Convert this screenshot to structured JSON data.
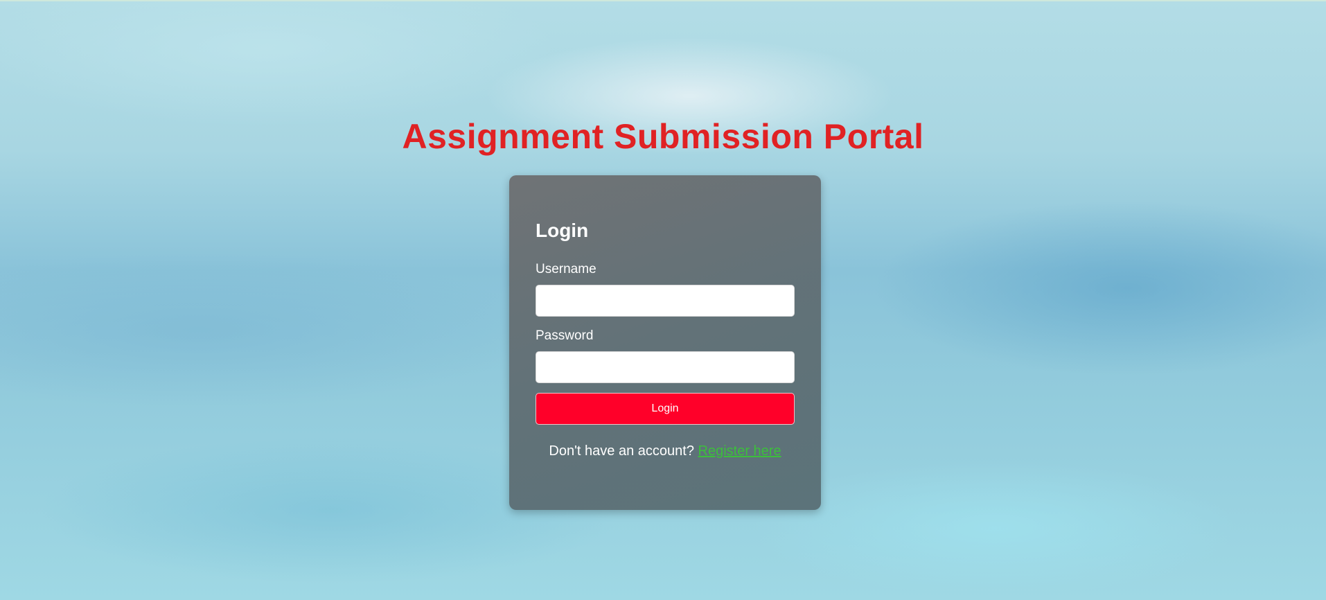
{
  "page": {
    "title": "Assignment Submission Portal"
  },
  "login_form": {
    "heading": "Login",
    "username_label": "Username",
    "username_value": "",
    "password_label": "Password",
    "password_value": "",
    "submit_label": "Login",
    "register_prompt": "Don't have an account?",
    "register_link_text": "Register here"
  },
  "colors": {
    "title": "#e02224",
    "button": "#ff0029",
    "link": "#3cbf3c"
  }
}
